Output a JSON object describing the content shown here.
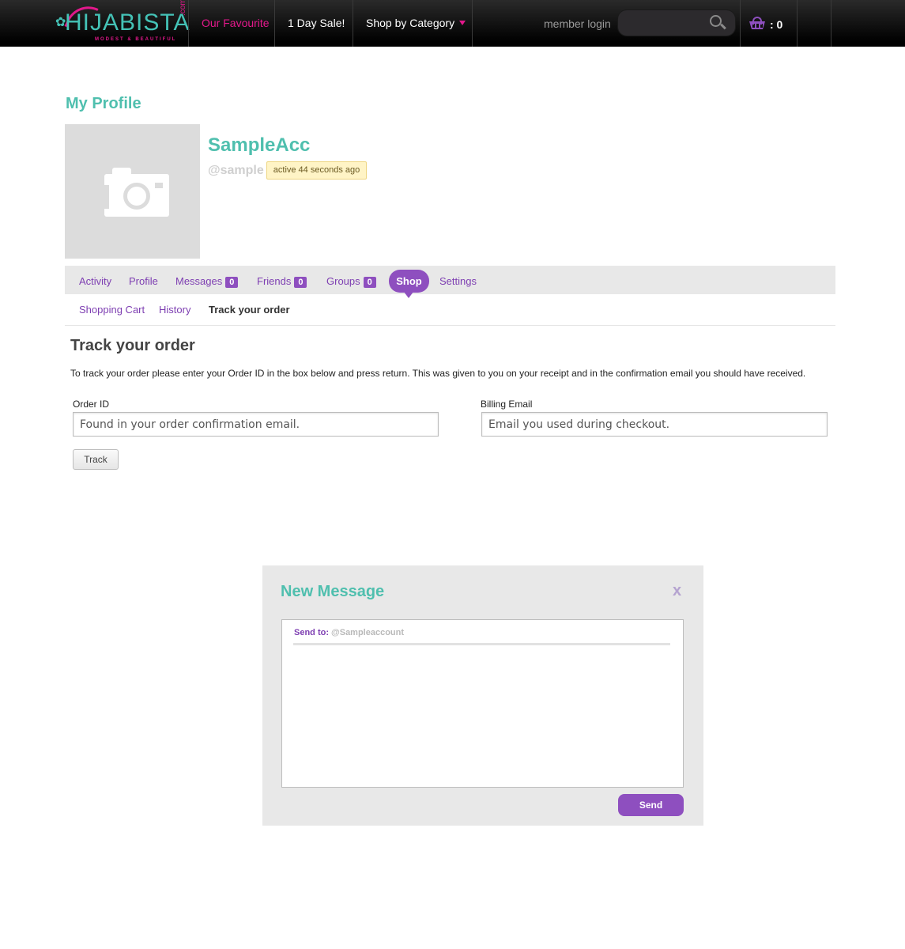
{
  "header": {
    "logo_text": "HIJABISTA",
    "logo_domain": ".com",
    "logo_tagline": "MODEST & BEAUTIFUL",
    "nav": {
      "favourite": "Our Favourite",
      "sale": "1 Day Sale!",
      "category": "Shop by Category"
    },
    "member_login": "member login",
    "search_placeholder": "",
    "cart_count": ": 0",
    "colors": {
      "accent_pink": "#e2188b",
      "accent_teal": "#44c2b6",
      "accent_purple": "#8e4fbf"
    }
  },
  "profile": {
    "page_title": "My Profile",
    "name": "SampleAcc",
    "handle": "@sample",
    "activity": "active 44 seconds ago",
    "avatar_icon": "camera-icon"
  },
  "tabs": {
    "items": [
      {
        "label": "Activity"
      },
      {
        "label": "Profile"
      },
      {
        "label": "Messages",
        "count": "0"
      },
      {
        "label": "Friends",
        "count": "0"
      },
      {
        "label": "Groups",
        "count": "0"
      },
      {
        "label": "Shop"
      },
      {
        "label": "Settings"
      }
    ],
    "active": "Shop",
    "subtabs": [
      {
        "label": "Shopping Cart"
      },
      {
        "label": "History"
      },
      {
        "label": "Track your order"
      }
    ]
  },
  "track": {
    "title": "Track your order",
    "instructions": "To track your order please enter your Order ID in the box below and press return. This was given to you on your receipt and in the confirmation email you should have received.",
    "order_label": "Order ID",
    "order_placeholder": "Found in your order confirmation email.",
    "email_label": "Billing Email",
    "email_placeholder": "Email you used during checkout.",
    "button": "Track"
  },
  "modal": {
    "title": "New Message",
    "close": "x",
    "send_to_label": "Send to:",
    "send_to_value": "@Sampleaccount",
    "send_button": "Send"
  }
}
